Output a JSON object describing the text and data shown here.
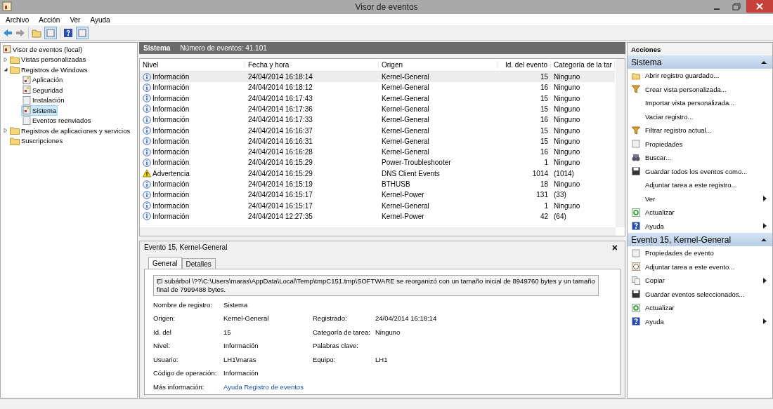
{
  "window": {
    "title": "Visor de eventos"
  },
  "menu": [
    {
      "label": "Archivo"
    },
    {
      "label": "Acción"
    },
    {
      "label": "Ver"
    },
    {
      "label": "Ayuda"
    }
  ],
  "tree": [
    {
      "label": "Visor de eventos (local)",
      "kind": "viewer",
      "selected": false,
      "children": [
        {
          "label": "Vistas personalizadas",
          "kind": "folder",
          "selected": false,
          "expanded": false
        },
        {
          "label": "Registros de Windows",
          "kind": "folder",
          "selected": false,
          "expanded": true,
          "children": [
            {
              "label": "Aplicación",
              "kind": "log",
              "selected": false
            },
            {
              "label": "Seguridad",
              "kind": "log",
              "selected": false
            },
            {
              "label": "Instalación",
              "kind": "page",
              "selected": false
            },
            {
              "label": "Sistema",
              "kind": "log",
              "selected": true
            },
            {
              "label": "Eventos reenviados",
              "kind": "page",
              "selected": false
            }
          ]
        },
        {
          "label": "Registros de aplicaciones y servicios",
          "kind": "folder",
          "selected": false,
          "expanded": false
        },
        {
          "label": "Suscripciones",
          "kind": "folder",
          "selected": false
        }
      ]
    }
  ],
  "log_header": {
    "title": "Sistema",
    "count": "Número de eventos: 41.101"
  },
  "table": {
    "columns": [
      "Nivel",
      "Fecha y hora",
      "Origen",
      "Id. del evento",
      "Categoría de la tar"
    ],
    "rows": [
      {
        "kind": "info",
        "level": "Información",
        "date": "24/04/2014 16:18:14",
        "source": "Kernel-General",
        "id": "15",
        "category": "Ninguno",
        "selected": true
      },
      {
        "kind": "info",
        "level": "Información",
        "date": "24/04/2014 16:18:12",
        "source": "Kernel-General",
        "id": "16",
        "category": "Ninguno",
        "selected": false
      },
      {
        "kind": "info",
        "level": "Información",
        "date": "24/04/2014 16:17:43",
        "source": "Kernel-General",
        "id": "15",
        "category": "Ninguno",
        "selected": false
      },
      {
        "kind": "info",
        "level": "Información",
        "date": "24/04/2014 16:17:36",
        "source": "Kernel-General",
        "id": "15",
        "category": "Ninguno",
        "selected": false
      },
      {
        "kind": "info",
        "level": "Información",
        "date": "24/04/2014 16:17:33",
        "source": "Kernel-General",
        "id": "16",
        "category": "Ninguno",
        "selected": false
      },
      {
        "kind": "info",
        "level": "Información",
        "date": "24/04/2014 16:16:37",
        "source": "Kernel-General",
        "id": "15",
        "category": "Ninguno",
        "selected": false
      },
      {
        "kind": "info",
        "level": "Información",
        "date": "24/04/2014 16:16:31",
        "source": "Kernel-General",
        "id": "15",
        "category": "Ninguno",
        "selected": false
      },
      {
        "kind": "info",
        "level": "Información",
        "date": "24/04/2014 16:16:28",
        "source": "Kernel-General",
        "id": "16",
        "category": "Ninguno",
        "selected": false
      },
      {
        "kind": "info",
        "level": "Información",
        "date": "24/04/2014 16:15:29",
        "source": "Power-Troubleshooter",
        "id": "1",
        "category": "Ninguno",
        "selected": false
      },
      {
        "kind": "warning",
        "level": "Advertencia",
        "date": "24/04/2014 16:15:29",
        "source": "DNS Client Events",
        "id": "1014",
        "category": "(1014)",
        "selected": false
      },
      {
        "kind": "info",
        "level": "Información",
        "date": "24/04/2014 16:15:19",
        "source": "BTHUSB",
        "id": "18",
        "category": "Ninguno",
        "selected": false
      },
      {
        "kind": "info",
        "level": "Información",
        "date": "24/04/2014 16:15:17",
        "source": "Kernel-Power",
        "id": "131",
        "category": "(33)",
        "selected": false
      },
      {
        "kind": "info",
        "level": "Información",
        "date": "24/04/2014 16:15:17",
        "source": "Kernel-General",
        "id": "1",
        "category": "Ninguno",
        "selected": false
      },
      {
        "kind": "info",
        "level": "Información",
        "date": "24/04/2014 12:27:35",
        "source": "Kernel-Power",
        "id": "42",
        "category": "(64)",
        "selected": false
      }
    ]
  },
  "detail": {
    "title": "Evento 15, Kernel-General",
    "close": "×",
    "tabs": [
      {
        "label": "General",
        "selected": true
      },
      {
        "label": "Detalles",
        "selected": false
      }
    ],
    "description": "El subárbol \\??\\C:\\Users\\maras\\AppData\\Local\\Temp\\tmpC151.tmp\\SOFTWARE se reorganizó con un tamaño inicial de 8949760 bytes y un tamaño final de 7999488 bytes.",
    "fields": [
      [
        {
          "label": "Nombre de registro:",
          "value": "Sistema"
        }
      ],
      [
        {
          "label": "Origen:",
          "value": "Kernel-General"
        },
        {
          "label": "Registrado:",
          "value": "24/04/2014 16:18:14"
        }
      ],
      [
        {
          "label": "Id. del",
          "value": "15"
        },
        {
          "label": "Categoría de tarea:",
          "value": "Ninguno"
        }
      ],
      [
        {
          "label": "Nivel:",
          "value": "Información"
        },
        {
          "label": "Palabras clave:"
        }
      ],
      [
        {
          "label": "Usuario:",
          "value": "LH1\\maras"
        },
        {
          "label": "Equipo:",
          "value": "LH1"
        }
      ],
      [
        {
          "label": "Código de operación:",
          "value": "Información"
        }
      ],
      [
        {
          "label": "Más información:",
          "link": "Ayuda Registro de eventos"
        }
      ]
    ]
  },
  "actions": {
    "title": "Acciones",
    "sections": [
      {
        "title": "Sistema",
        "items": [
          {
            "label": "Abrir registro guardado...",
            "kind": "open"
          },
          {
            "label": "Crear vista personalizada...",
            "kind": "filter"
          },
          {
            "label": "Importar vista personalizada...",
            "kind": "none"
          },
          {
            "label": "Vaciar registro...",
            "kind": "none"
          },
          {
            "label": "Filtrar registro actual...",
            "kind": "filter"
          },
          {
            "label": "Propiedades",
            "kind": "page"
          },
          {
            "label": "Buscar...",
            "kind": "find"
          },
          {
            "label": "Guardar todos los eventos como...",
            "kind": "save"
          },
          {
            "label": "Adjuntar tarea a este registro...",
            "kind": "none"
          },
          {
            "label": "Ver",
            "kind": "none",
            "submenu": true
          },
          {
            "label": "Actualizar",
            "kind": "refresh"
          },
          {
            "label": "Ayuda",
            "kind": "help",
            "submenu": true
          }
        ]
      },
      {
        "title": "Evento 15, Kernel-General",
        "items": [
          {
            "label": "Propiedades de evento",
            "kind": "page"
          },
          {
            "label": "Adjuntar tarea a este evento...",
            "kind": "task"
          },
          {
            "label": "Copiar",
            "kind": "copy",
            "submenu": true
          },
          {
            "label": "Guardar eventos seleccionados...",
            "kind": "save"
          },
          {
            "label": "Actualizar",
            "kind": "refresh"
          },
          {
            "label": "Ayuda",
            "kind": "help",
            "submenu": true
          }
        ]
      }
    ]
  }
}
